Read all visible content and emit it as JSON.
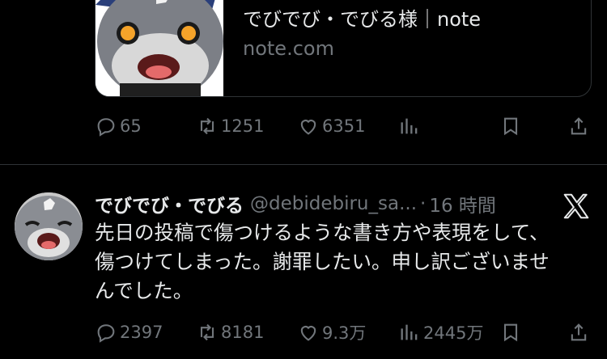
{
  "card": {
    "title": "でびでび・でびる様｜note",
    "domain": "note.com"
  },
  "actions1": {
    "replies": "65",
    "retweets": "1251",
    "likes": "6351"
  },
  "tweet": {
    "name": "でびでび・でびる",
    "handle": "@debidebiru_sa...",
    "dot": "·",
    "time": "16 時間",
    "text": "先日の投稿で傷つけるような書き方や表現をして、\n傷つけてしまった。謝罪したい。申し訳ございませ\nんでした。"
  },
  "actions2": {
    "replies": "2397",
    "retweets": "8181",
    "likes": "9.3万",
    "views": "2445万"
  },
  "colors": {
    "bg": "#000000",
    "text": "#e7e9ea",
    "muted": "#71767b",
    "border": "#2f3336"
  }
}
